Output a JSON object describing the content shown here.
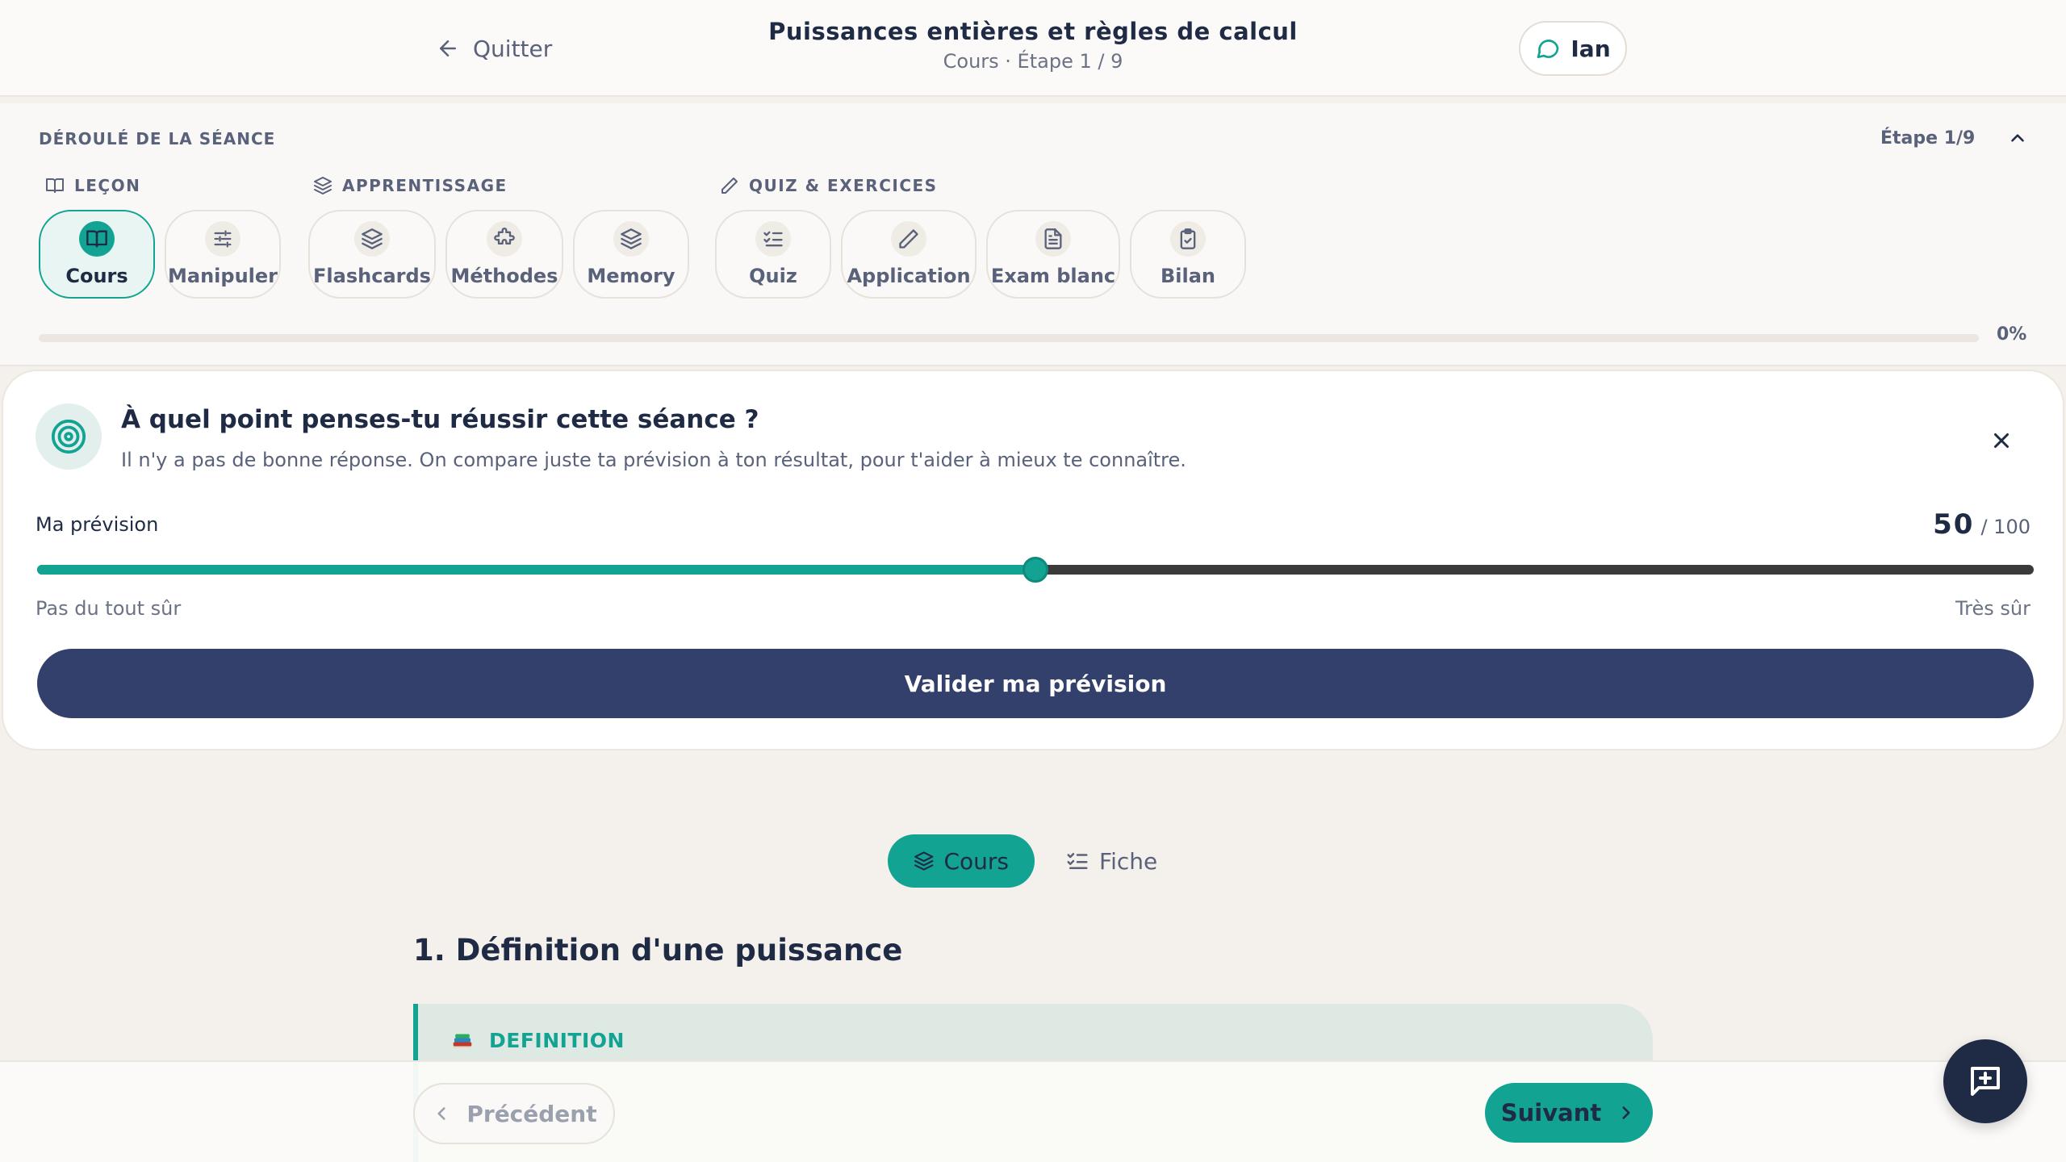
{
  "header": {
    "quit_label": "Quitter",
    "title": "Puissances entières et règles de calcul",
    "subtitle": "Cours · Étape 1 / 9",
    "user_name": "Ian"
  },
  "session": {
    "title": "DÉROULÉ DE LA SÉANCE",
    "step_indicator": "Étape 1/9",
    "groups": {
      "lesson": "LEÇON",
      "learning": "APPRENTISSAGE",
      "quiz": "QUIZ & EXERCICES"
    },
    "steps": [
      {
        "label": "Cours",
        "icon": "book-open-icon",
        "active": true
      },
      {
        "label": "Manipuler",
        "icon": "sliders-icon",
        "active": false
      },
      {
        "label": "Flashcards",
        "icon": "layers-icon",
        "active": false
      },
      {
        "label": "Méthodes",
        "icon": "puzzle-icon",
        "active": false
      },
      {
        "label": "Memory",
        "icon": "layers-icon",
        "active": false
      },
      {
        "label": "Quiz",
        "icon": "list-checks-icon",
        "active": false
      },
      {
        "label": "Application",
        "icon": "pencil-icon",
        "active": false
      },
      {
        "label": "Exam blanc",
        "icon": "file-text-icon",
        "active": false
      },
      {
        "label": "Bilan",
        "icon": "clipboard-check-icon",
        "active": false
      }
    ],
    "progress_percent": 0,
    "progress_label": "0%"
  },
  "prediction": {
    "question": "À quel point penses-tu réussir cette séance ?",
    "subtitle": "Il n'y a pas de bonne réponse. On compare juste ta prévision à ton résultat, pour t'aider à mieux te connaître.",
    "label": "Ma prévision",
    "value": 50,
    "value_text": "50",
    "max_text": "/ 100",
    "max": 100,
    "scale_low": "Pas du tout sûr",
    "scale_high": "Très sûr",
    "submit_label": "Valider ma prévision"
  },
  "content": {
    "tabs": [
      {
        "label": "Cours",
        "active": true
      },
      {
        "label": "Fiche",
        "active": false
      }
    ],
    "section_title": "1. Définition d'une puissance",
    "definition_label": "DEFINITION"
  },
  "nav": {
    "prev_label": "Précédent",
    "next_label": "Suivant"
  },
  "colors": {
    "accent": "#12a393",
    "primary": "#32406b",
    "text": "#1f2a44"
  }
}
